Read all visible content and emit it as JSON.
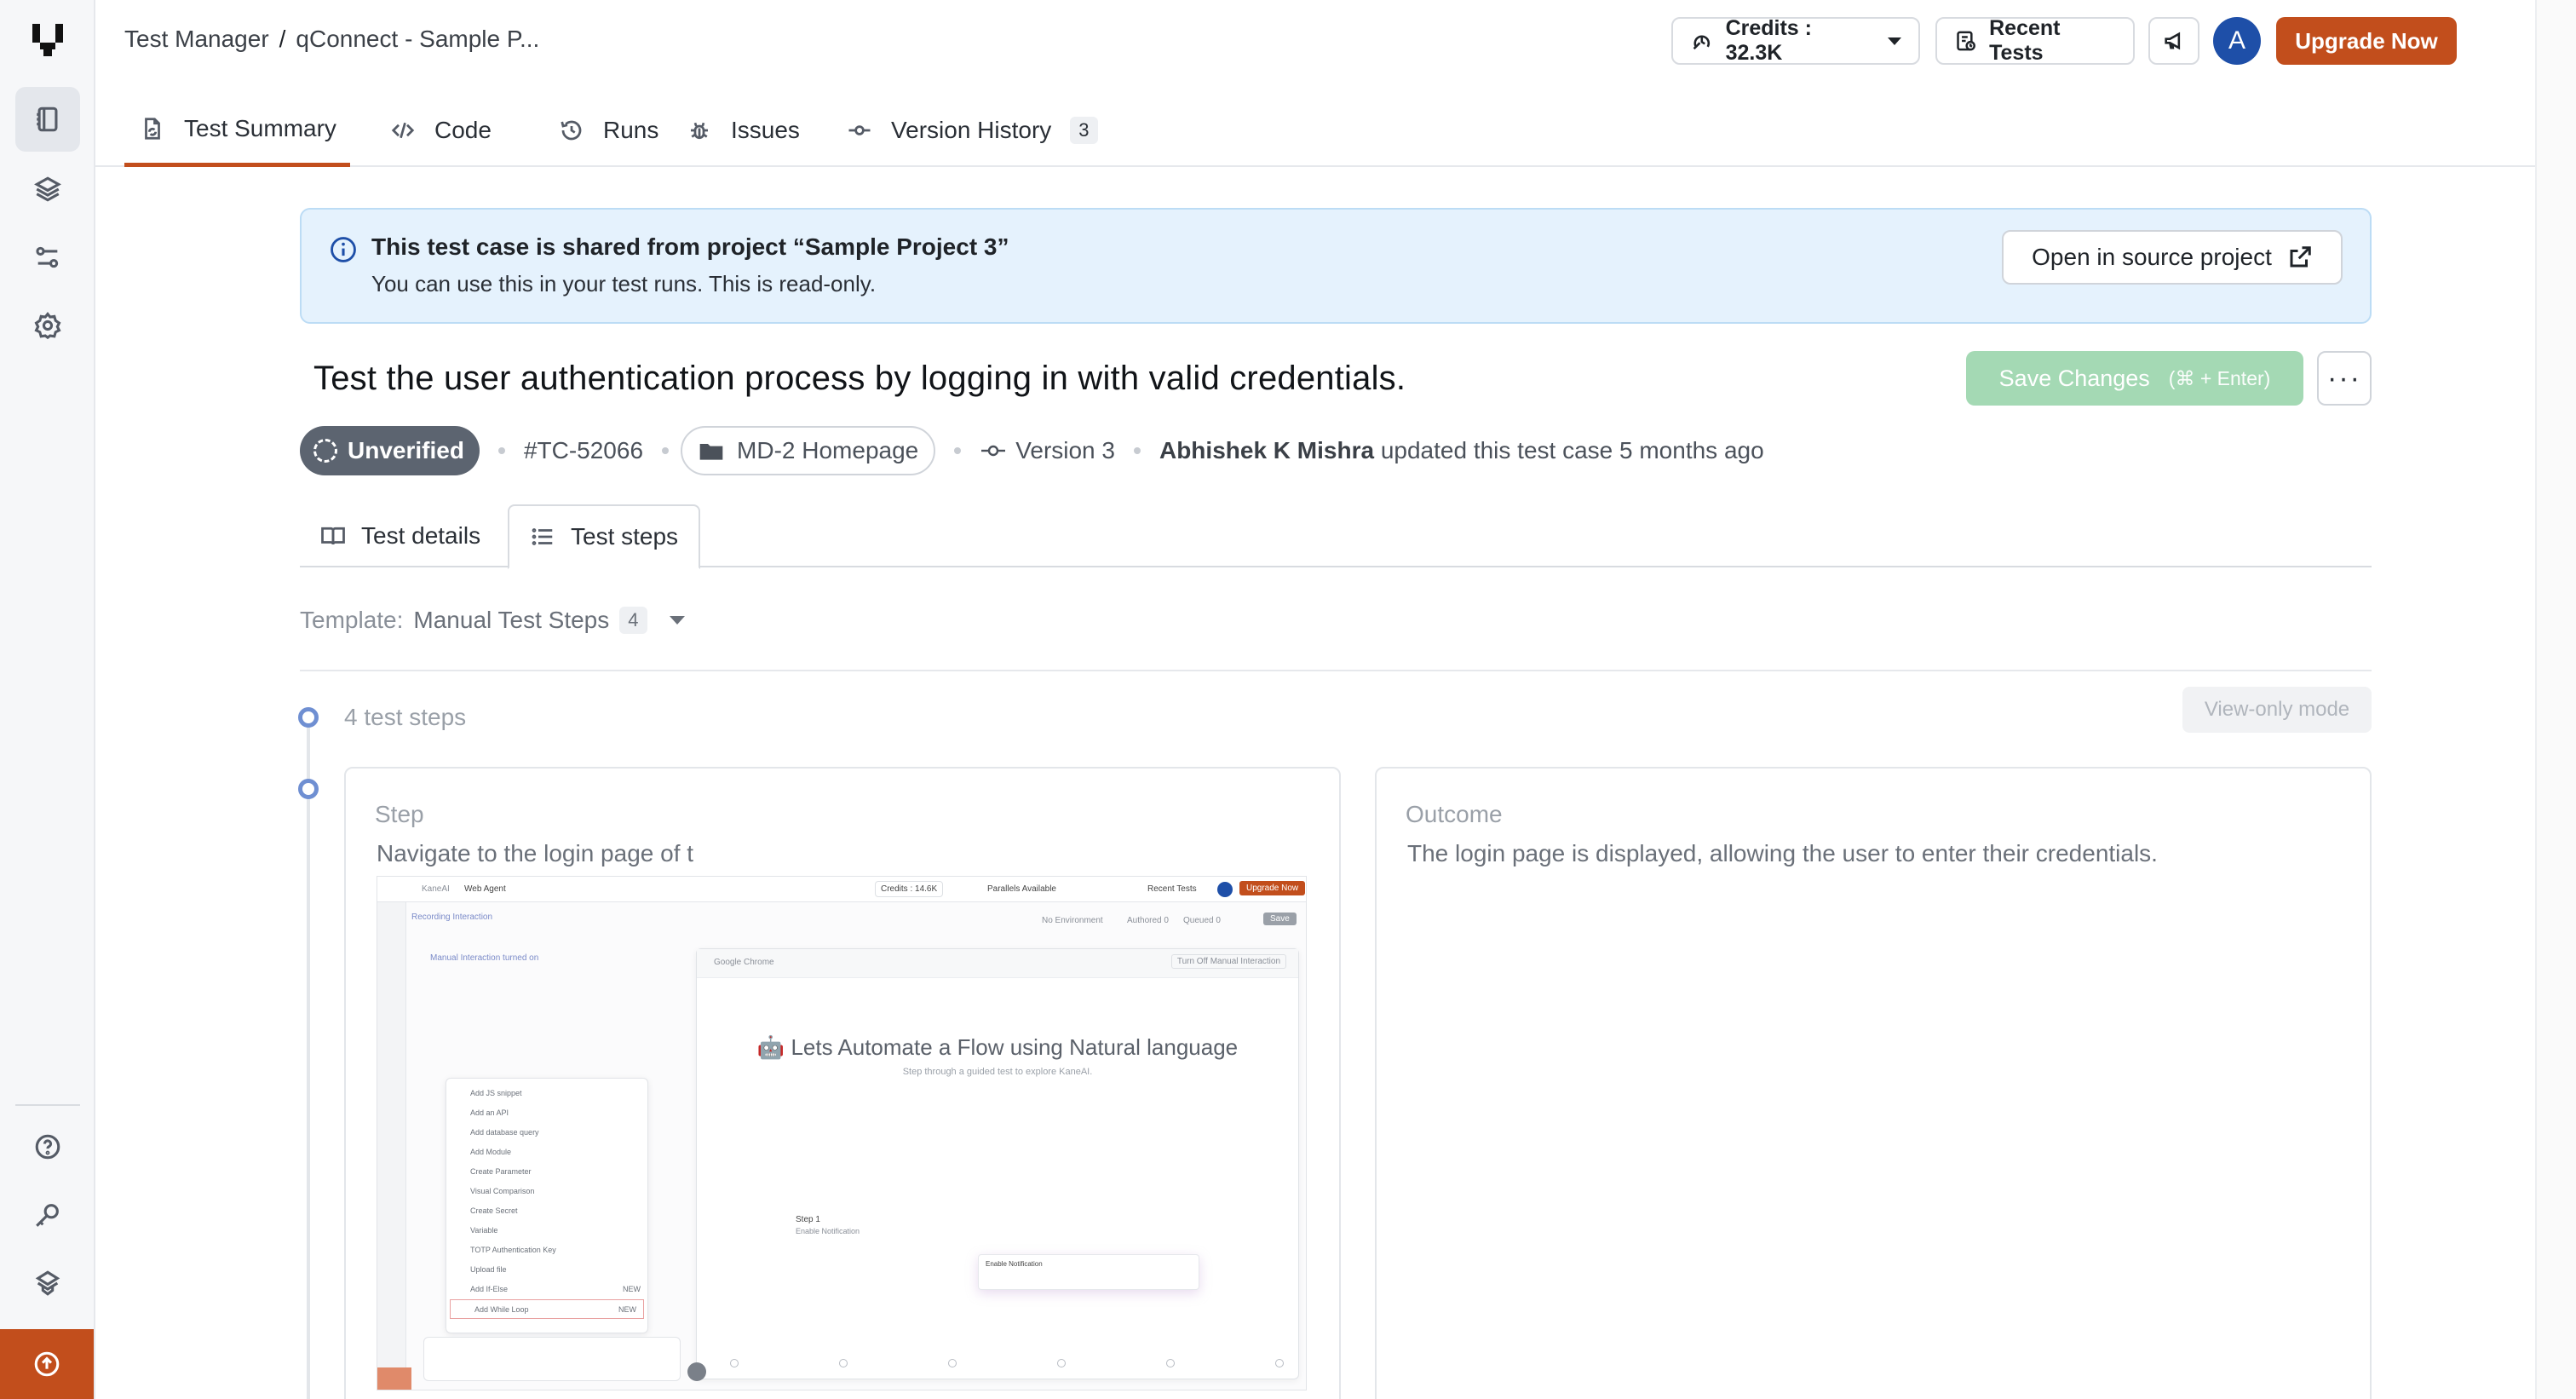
{
  "breadcrumb": {
    "root": "Test Manager",
    "separator": "/",
    "current": "qConnect - Sample P..."
  },
  "header": {
    "credits_label": "Credits : 32.3K",
    "recent_tests_label": "Recent Tests",
    "avatar_initial": "A",
    "upgrade_label": "Upgrade Now"
  },
  "tabs": [
    {
      "label": "Test Summary",
      "icon": "file-sync-icon",
      "active": true
    },
    {
      "label": "Code",
      "icon": "code-icon"
    },
    {
      "label": "Runs",
      "icon": "history-icon"
    },
    {
      "label": "Issues",
      "icon": "bug-icon"
    },
    {
      "label": "Version History",
      "icon": "commit-icon",
      "count": "3"
    }
  ],
  "banner": {
    "title": "This test case is shared from project “Sample Project 3”",
    "subtitle": "You can use this in your test runs. This is read-only.",
    "open_label": "Open in source project"
  },
  "test_case": {
    "title": "Test the user authentication process by logging in with valid credentials.",
    "save_label": "Save Changes",
    "save_shortcut": "(⌘ + Enter)",
    "more_label": "···",
    "status": "Unverified",
    "id": "#TC-52066",
    "folder": "MD-2 Homepage",
    "version": "Version 3",
    "author": "Abhishek K Mishra",
    "updated_text": "updated this test case 5 months ago"
  },
  "subtabs": [
    {
      "label": "Test details",
      "icon": "book-open-icon"
    },
    {
      "label": "Test steps",
      "icon": "list-icon",
      "active": true
    }
  ],
  "template": {
    "label": "Template:",
    "name": "Manual Test Steps",
    "count": "4"
  },
  "steps": {
    "count_label": "4 test steps",
    "view_only_label": "View-only mode",
    "step_label": "Step",
    "outcome_label": "Outcome",
    "items": [
      {
        "step_text": "Navigate to the login page of t",
        "outcome_text": "The login page is displayed, allowing the user to enter their credentials."
      }
    ]
  },
  "embedded_screenshot": {
    "app_name": "KaneAI",
    "section": "Web Agent",
    "credits": "Credits : 14.6K",
    "parallels": "Parallels Available",
    "recent_tests": "Recent Tests",
    "upgrade": "Upgrade Now",
    "recording": "Recording Interaction",
    "manual_on": "Manual Interaction turned on",
    "no_environment": "No Environment",
    "authored": "Authored 0",
    "queued": "Queued 0",
    "save": "Save",
    "browser_name": "Google Chrome",
    "turn_off": "Turn Off Manual Interaction",
    "headline": "🤖 Lets Automate a Flow using Natural language",
    "subheadline": "Step through a guided test to explore KaneAI.",
    "menu_items": [
      "Add JS snippet",
      "Add an API",
      "Add database query",
      "Add Module",
      "Create Parameter",
      "Visual Comparison",
      "Create Secret",
      "Variable",
      "TOTP Authentication Key",
      "Upload file",
      "Add If-Else",
      "Add While Loop"
    ],
    "step1_title": "Step 1",
    "step1_sub": "Enable Notification",
    "notif_title": "Enable Notification",
    "menu_new_badge": "NEW"
  }
}
